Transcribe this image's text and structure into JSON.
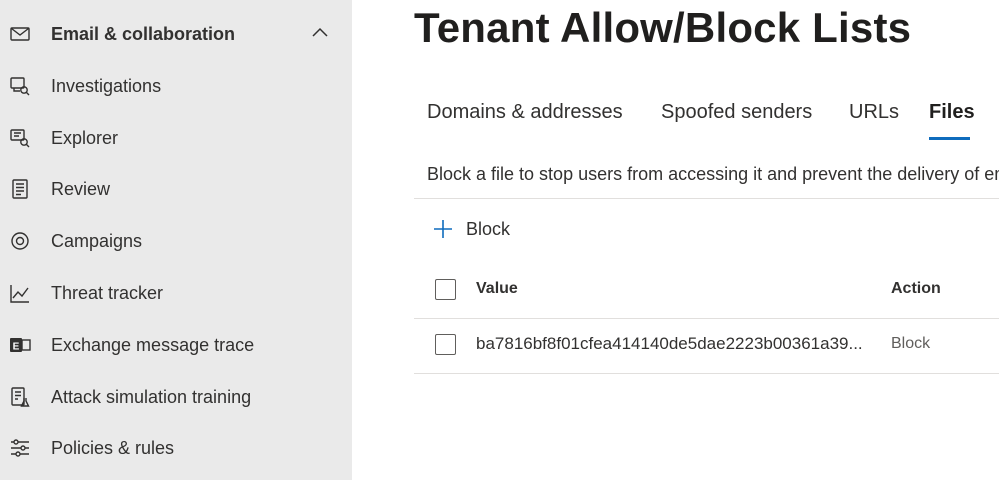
{
  "sidebar": {
    "section_header": {
      "label": "Email & collaboration",
      "icon": "mail-icon",
      "expanded": true
    },
    "items": [
      {
        "label": "Investigations",
        "icon": "investigations-icon"
      },
      {
        "label": "Explorer",
        "icon": "explorer-icon"
      },
      {
        "label": "Review",
        "icon": "review-icon"
      },
      {
        "label": "Campaigns",
        "icon": "campaigns-icon"
      },
      {
        "label": "Threat tracker",
        "icon": "threat-tracker-icon"
      },
      {
        "label": "Exchange message trace",
        "icon": "exchange-icon"
      },
      {
        "label": "Attack simulation training",
        "icon": "attack-simulation-icon"
      },
      {
        "label": "Policies & rules",
        "icon": "policies-icon"
      }
    ]
  },
  "main": {
    "title": "Tenant Allow/Block Lists",
    "tabs": [
      {
        "label": "Domains & addresses",
        "active": false
      },
      {
        "label": "Spoofed senders",
        "active": false
      },
      {
        "label": "URLs",
        "active": false
      },
      {
        "label": "Files",
        "active": true
      }
    ],
    "description": "Block a file to stop users from accessing it and prevent the delivery of em",
    "toolbar": {
      "block_label": "Block"
    },
    "table": {
      "columns": [
        "Value",
        "Action"
      ],
      "rows": [
        {
          "value": "ba7816bf8f01cfea414140de5dae2223b00361a39...",
          "action": "Block"
        }
      ]
    }
  },
  "colors": {
    "accent": "#0f6cbd",
    "sidebar_bg": "#eaeaea"
  }
}
